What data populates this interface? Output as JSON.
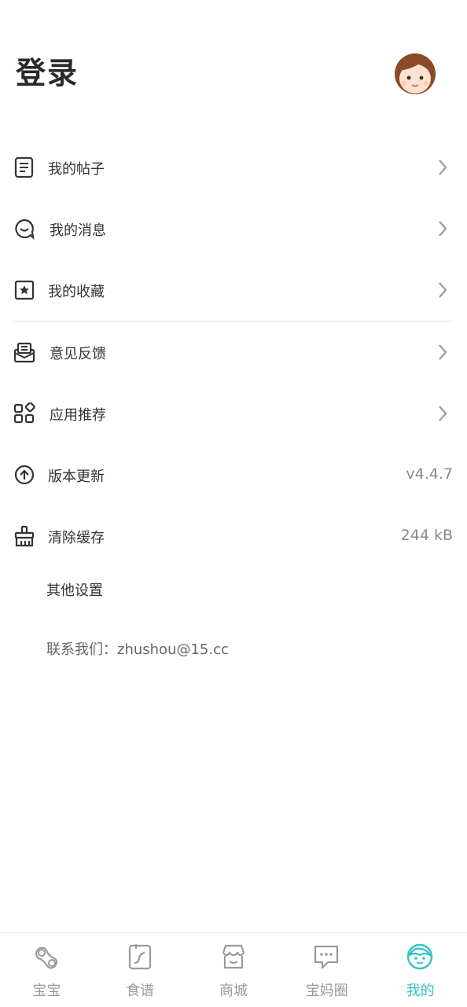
{
  "header": {
    "title": "登录"
  },
  "menu": {
    "posts": {
      "label": "我的帖子"
    },
    "messages": {
      "label": "我的消息"
    },
    "favorites": {
      "label": "我的收藏"
    },
    "feedback": {
      "label": "意见反馈"
    },
    "apps": {
      "label": "应用推荐"
    },
    "version": {
      "label": "版本更新",
      "value": "v4.4.7"
    },
    "cache": {
      "label": "清除缓存",
      "value": "244 kB"
    },
    "other": {
      "label": "其他设置"
    },
    "contact": "联系我们：zhushou@15.cc"
  },
  "tabs": [
    {
      "label": "宝宝",
      "icon": "baby-icon"
    },
    {
      "label": "食谱",
      "icon": "recipe-icon"
    },
    {
      "label": "商城",
      "icon": "shop-icon"
    },
    {
      "label": "宝妈圈",
      "icon": "chat-icon"
    },
    {
      "label": "我的",
      "icon": "profile-icon",
      "active": true
    }
  ],
  "colors": {
    "accent": "#33c3c3",
    "text": "#333333",
    "muted": "#9a9a9a"
  }
}
